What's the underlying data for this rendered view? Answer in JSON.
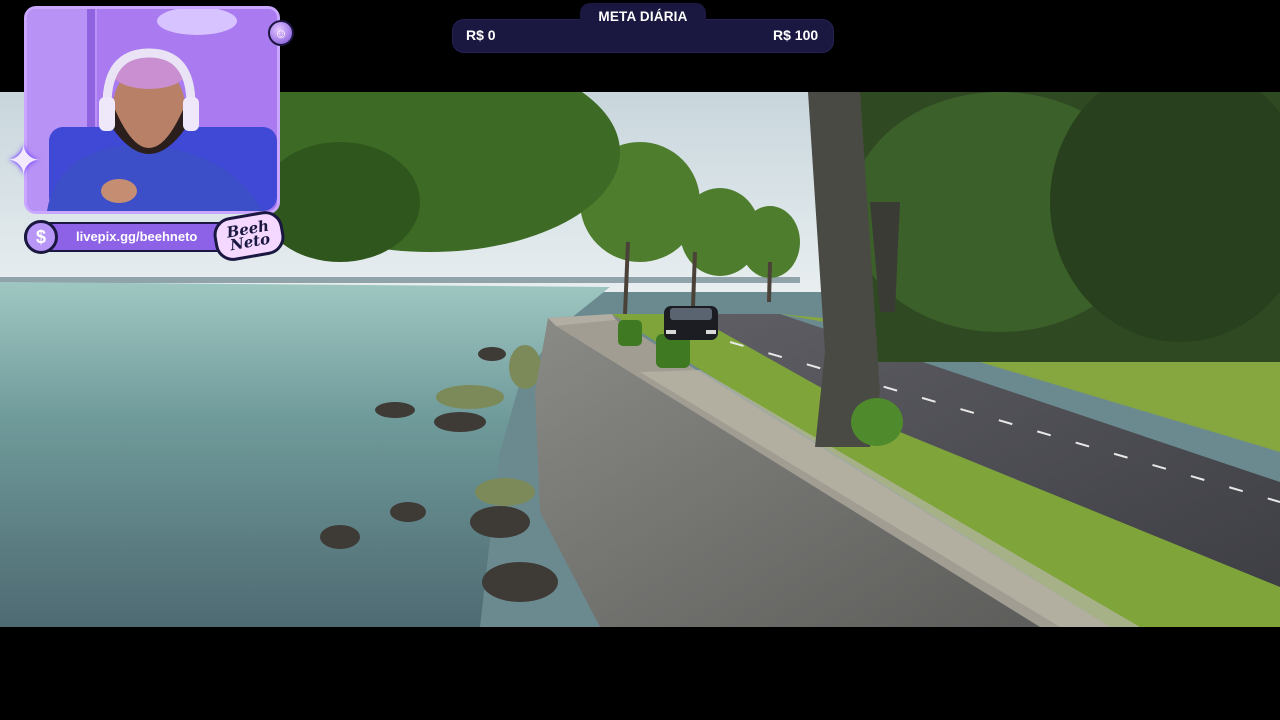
{
  "goal": {
    "title": "META DIÁRIA",
    "min_label": "R$ 0",
    "max_label": "R$ 100",
    "progress": 0
  },
  "donation": {
    "url": "livepix.gg/beehneto",
    "coin_symbol": "$"
  },
  "logo": {
    "text": "Beeh Neto"
  },
  "icons": {
    "coin": "dollar-coin-icon",
    "badge": "emoji-face-icon",
    "sparkle": "sparkle-icon"
  },
  "colors": {
    "goal_bar": "#1a1840",
    "accent_purple": "#8d62e6"
  }
}
